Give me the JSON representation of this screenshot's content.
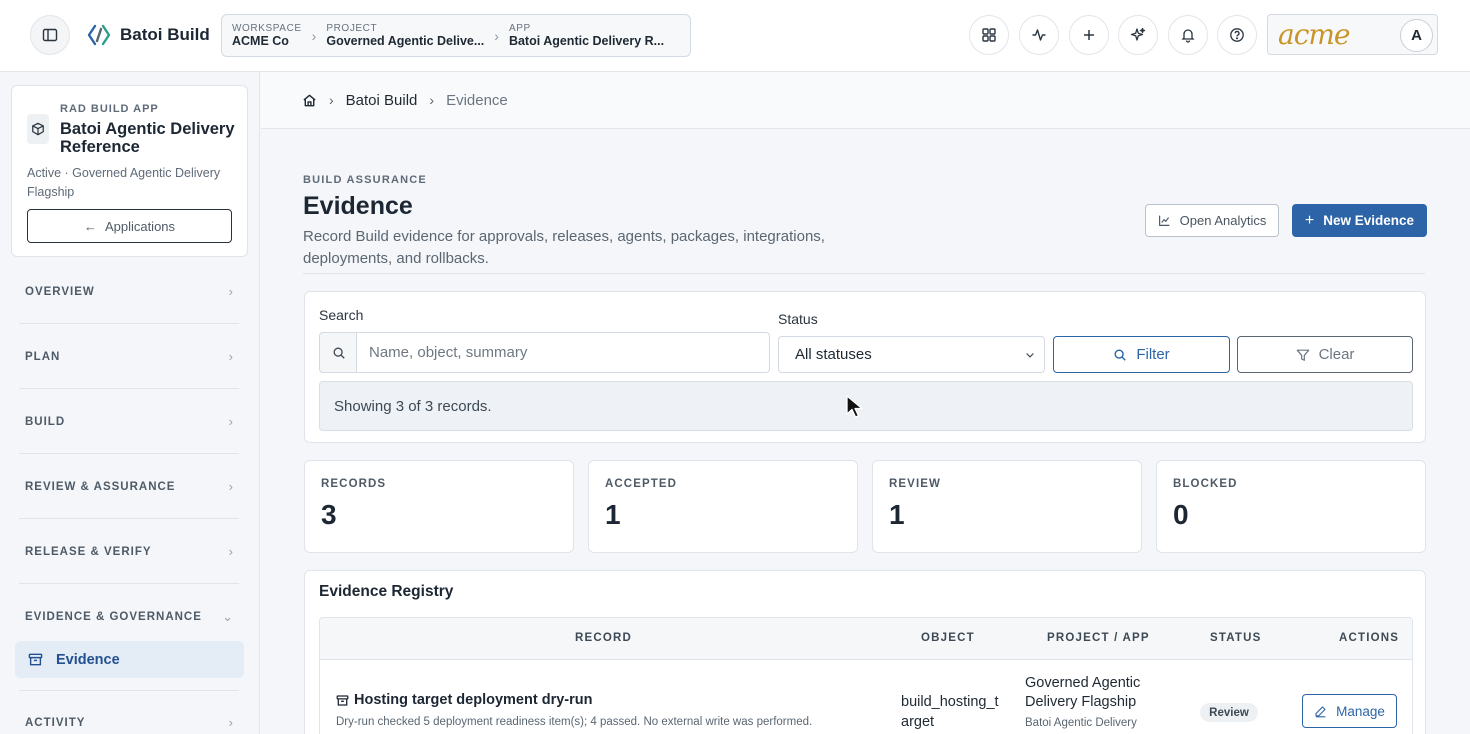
{
  "topbar": {
    "brand": "Batoi Build",
    "breadcrumbs": [
      {
        "label": "WORKSPACE",
        "value": "ACME Co"
      },
      {
        "label": "PROJECT",
        "value": "Governed Agentic Delive..."
      },
      {
        "label": "APP",
        "value": "Batoi Agentic Delivery R..."
      }
    ],
    "logo_text": "acme",
    "avatar_initial": "A",
    "icons": [
      "grid-icon",
      "activity-icon",
      "plus-icon",
      "sparkle-icon",
      "bell-icon",
      "help-icon"
    ]
  },
  "sidebar": {
    "app_tag": "RAD BUILD APP",
    "app_name": "Batoi Agentic Delivery Reference",
    "app_desc": "Active · Governed Agentic Delivery Flagship",
    "applications_label": "Applications",
    "sections": [
      "OVERVIEW",
      "PLAN",
      "BUILD",
      "REVIEW & ASSURANCE",
      "RELEASE & VERIFY",
      "EVIDENCE & GOVERNANCE",
      "ACTIVITY"
    ],
    "active_item": "Evidence"
  },
  "breadcrumb": {
    "root": "Batoi Build",
    "current": "Evidence"
  },
  "header": {
    "eyebrow": "BUILD ASSURANCE",
    "title": "Evidence",
    "description": "Record Build evidence for approvals, releases, agents, packages, integrations, deployments, and rollbacks.",
    "analytics_label": "Open Analytics",
    "new_label": "New Evidence"
  },
  "filters": {
    "search_label": "Search",
    "search_placeholder": "Name, object, summary",
    "status_label": "Status",
    "status_value": "All statuses",
    "filter_label": "Filter",
    "clear_label": "Clear",
    "showing": "Showing 3 of 3 records."
  },
  "stats": [
    {
      "label": "RECORDS",
      "value": "3"
    },
    {
      "label": "ACCEPTED",
      "value": "1"
    },
    {
      "label": "REVIEW",
      "value": "1"
    },
    {
      "label": "BLOCKED",
      "value": "0"
    }
  ],
  "registry": {
    "title": "Evidence Registry",
    "columns": [
      "RECORD",
      "OBJECT",
      "PROJECT / APP",
      "STATUS",
      "ACTIONS"
    ],
    "rows": [
      {
        "title": "Hosting target deployment dry-run",
        "summary": "Dry-run checked 5 deployment readiness item(s); 4 passed. No external write was performed.",
        "object": "build_hosting_target",
        "project": "Governed Agentic Delivery Flagship",
        "app": "Batoi Agentic Delivery",
        "status": "Review",
        "action": "Manage"
      }
    ]
  },
  "colors": {
    "accent": "#2d64a8",
    "brand_logo": "#c89628"
  }
}
